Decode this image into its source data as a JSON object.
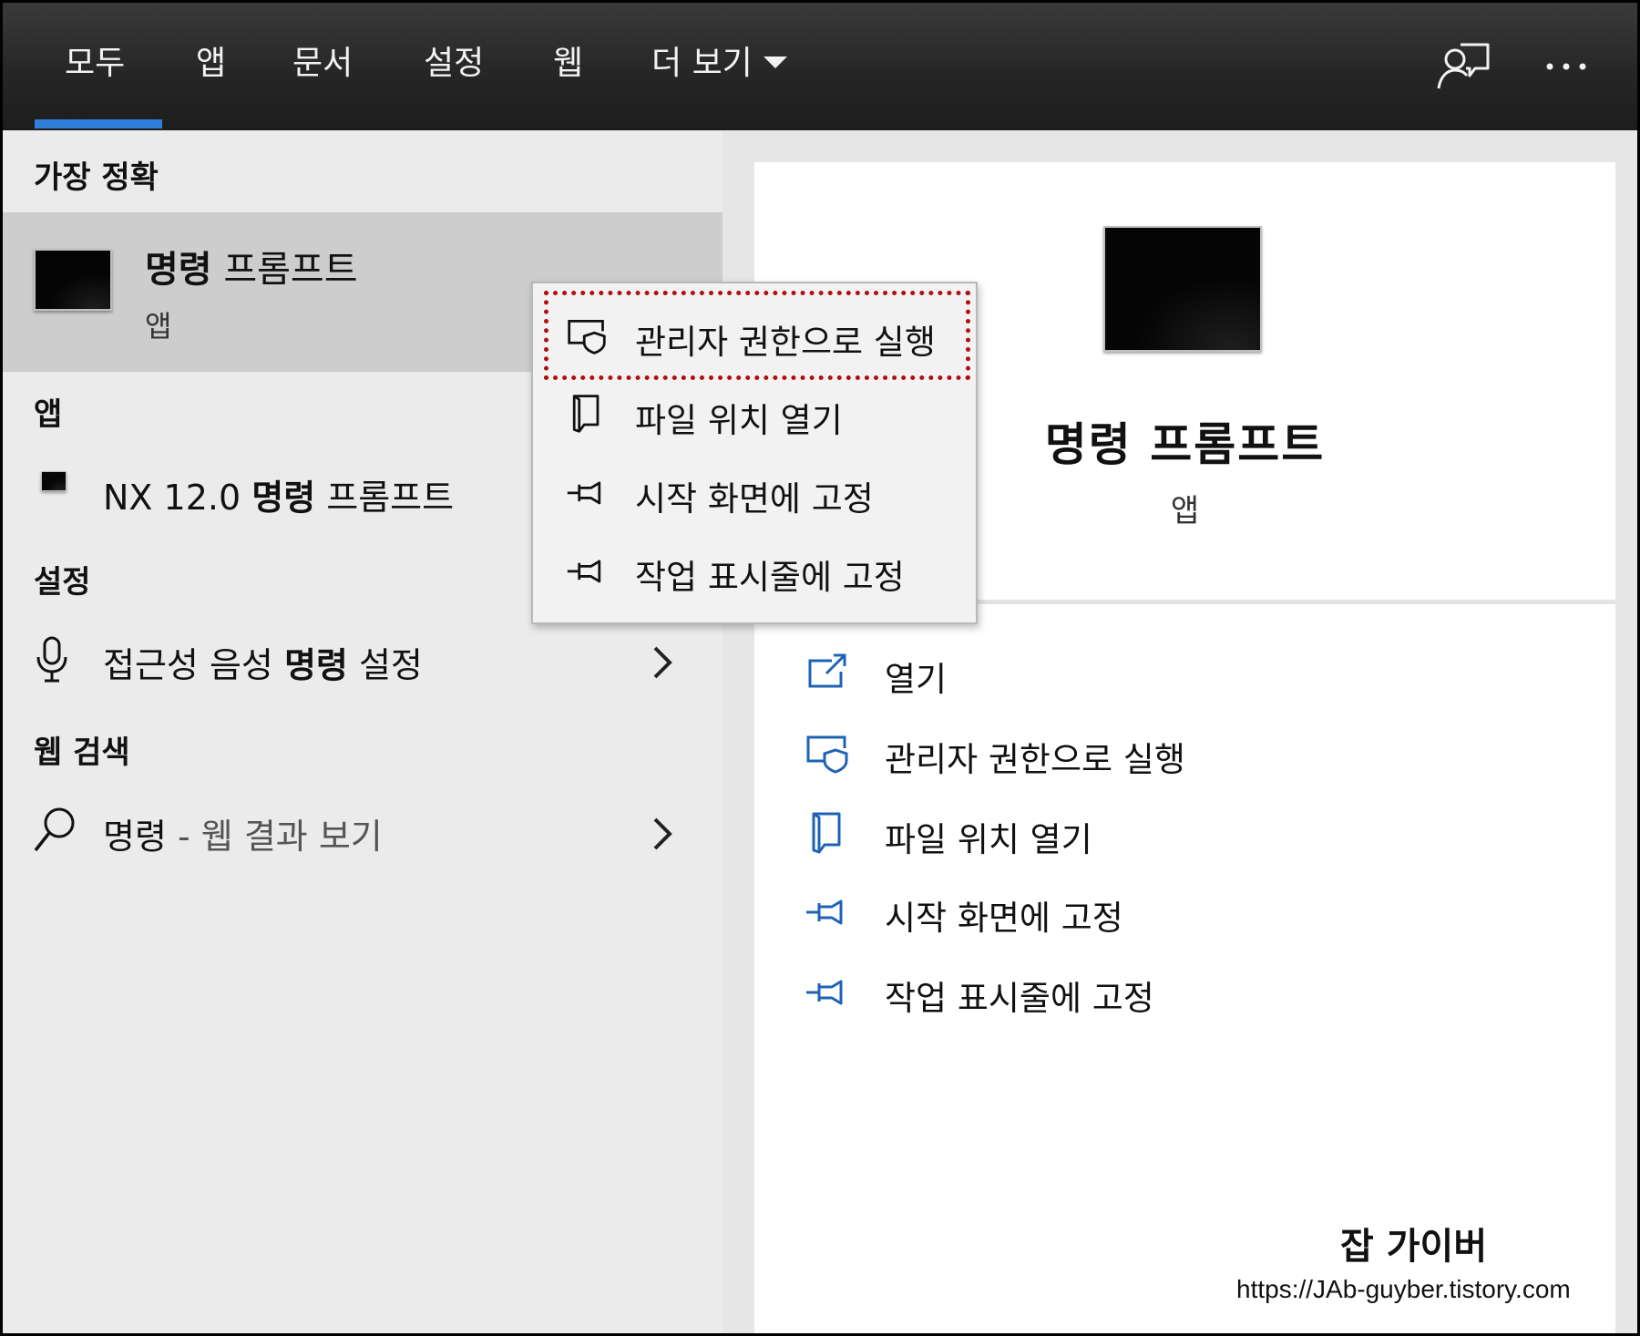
{
  "tabs": [
    {
      "label": "모두",
      "active": true
    },
    {
      "label": "앱"
    },
    {
      "label": "문서"
    },
    {
      "label": "설정"
    },
    {
      "label": "웹"
    },
    {
      "label": "더 보기"
    }
  ],
  "top_icons": [
    "feedback-icon",
    "more-options-icon"
  ],
  "colors": {
    "accent": "#2f7fd8",
    "action_blue": "#1f63b5",
    "highlight_border": "#b30d0d",
    "topbar": "#262626"
  },
  "left": {
    "best_match_heading": "가장 정확",
    "best_match": {
      "title_bold": "명령",
      "title_rest": " 프롬프트",
      "subtitle": "앱"
    },
    "apps_heading": "앱",
    "app_item": {
      "prefix": "NX 12.0 ",
      "bold": "명령",
      "suffix": " 프롬프트"
    },
    "settings_heading": "설정",
    "settings_item": {
      "prefix": "접근성 음성 ",
      "bold": "명령",
      "suffix": " 설정"
    },
    "web_heading": "웹 검색",
    "web_item": {
      "term": "명령",
      "suffix": " - 웹 결과 보기"
    }
  },
  "context_menu": {
    "items": [
      {
        "label": "관리자 권한으로 실행",
        "icon": "shield-icon",
        "highlighted": true
      },
      {
        "label": "파일 위치 열기",
        "icon": "file-location-icon"
      },
      {
        "label": "시작 화면에 고정",
        "icon": "pin-icon"
      },
      {
        "label": "작업 표시줄에 고정",
        "icon": "pin-icon"
      }
    ]
  },
  "right": {
    "title": "명령 프롬프트",
    "subtitle": "앱",
    "actions": [
      {
        "label": "열기",
        "icon": "open-icon"
      },
      {
        "label": "관리자 권한으로 실행",
        "icon": "shield-icon"
      },
      {
        "label": "파일 위치 열기",
        "icon": "file-location-icon"
      },
      {
        "label": "시작 화면에 고정",
        "icon": "pin-icon"
      },
      {
        "label": "작업 표시줄에 고정",
        "icon": "pin-icon"
      }
    ]
  },
  "watermark": {
    "title": "잡 가이버",
    "url": "https://JAb-guyber.tistory.com"
  }
}
